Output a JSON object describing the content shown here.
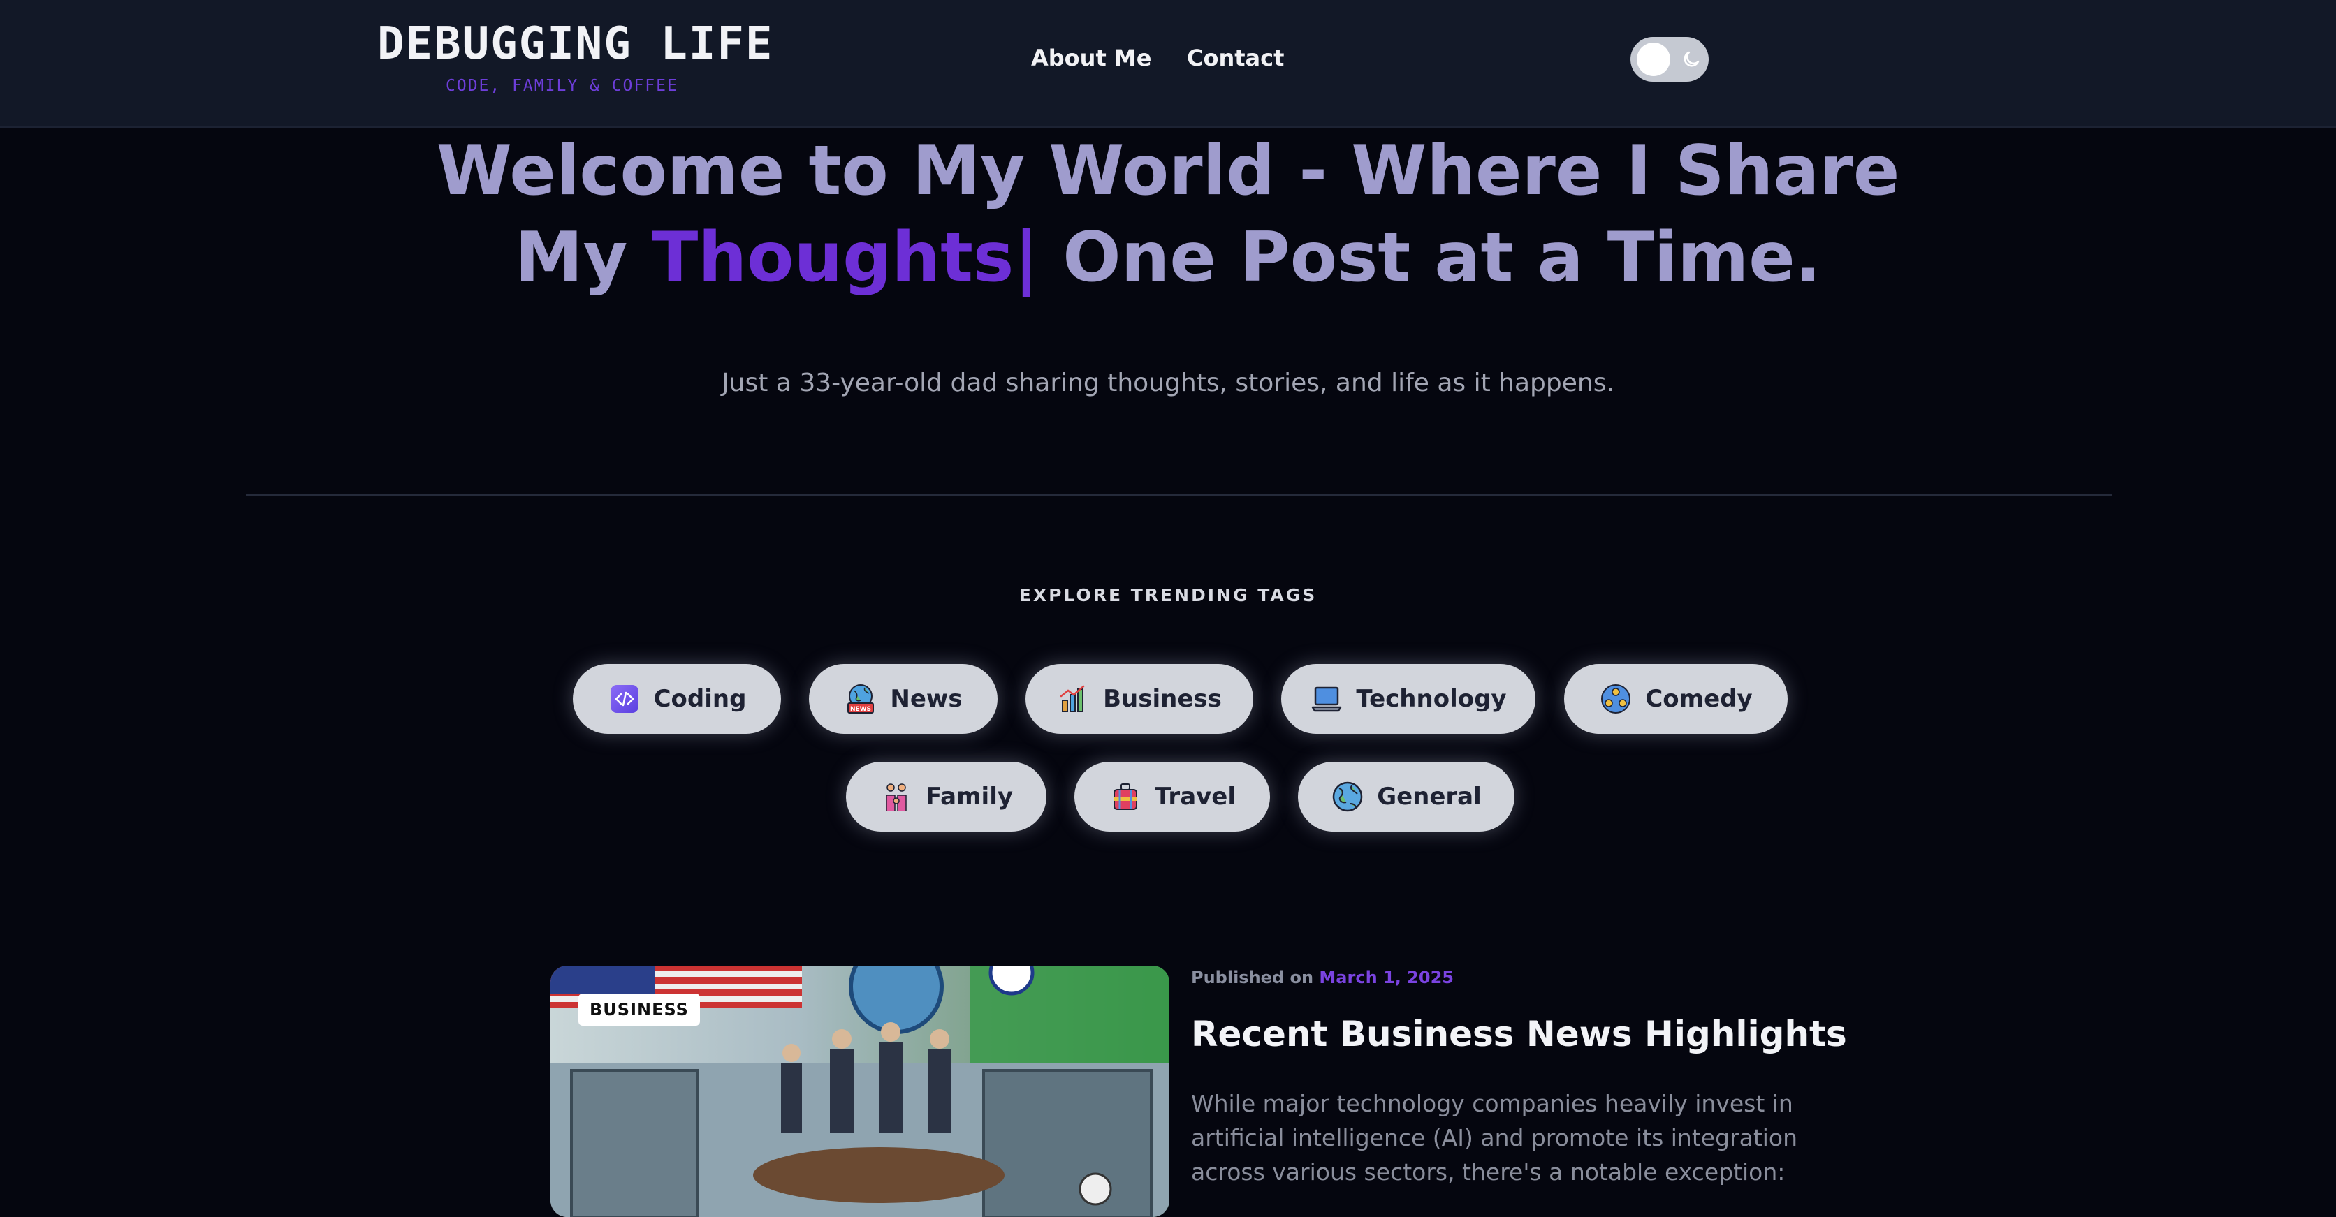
{
  "header": {
    "logo_title": "DEBUGGING LIFE",
    "logo_subtitle": "CODE, FAMILY & COFFEE",
    "nav": [
      "About Me",
      "Contact"
    ],
    "theme_toggle_icon": "moon-icon"
  },
  "hero": {
    "title_line1": "Welcome to My World - Where I Share",
    "title_line2_pre": "My ",
    "title_line2_accent": "Thoughts|",
    "title_line2_post": " One Post at a Time.",
    "subtitle": "Just a 33-year-old dad sharing thoughts, stories, and life as it happens."
  },
  "tags_section": {
    "label": "EXPLORE TRENDING TAGS",
    "tags": [
      {
        "label": "Coding",
        "icon": "code-icon"
      },
      {
        "label": "News",
        "icon": "news-globe-icon"
      },
      {
        "label": "Business",
        "icon": "business-chart-icon"
      },
      {
        "label": "Technology",
        "icon": "laptop-icon"
      },
      {
        "label": "Comedy",
        "icon": "comedy-icon"
      },
      {
        "label": "Family",
        "icon": "family-icon"
      },
      {
        "label": "Travel",
        "icon": "luggage-icon"
      },
      {
        "label": "General",
        "icon": "globe-icon"
      }
    ]
  },
  "post": {
    "category": "BUSINESS",
    "published_prefix": "Published on ",
    "date": "March 1, 2025",
    "title": "Recent Business News Highlights",
    "excerpt_lines": [
      "While major technology companies heavily invest in",
      "artificial intelligence (AI) and promote its integration",
      "across various sectors, there's a notable exception:"
    ]
  },
  "colors": {
    "background": "#05060f",
    "header": "#121827",
    "accent": "#6d2fd6",
    "hero_text": "#9f9ccd",
    "tag_pill": "#d2d5dc"
  }
}
